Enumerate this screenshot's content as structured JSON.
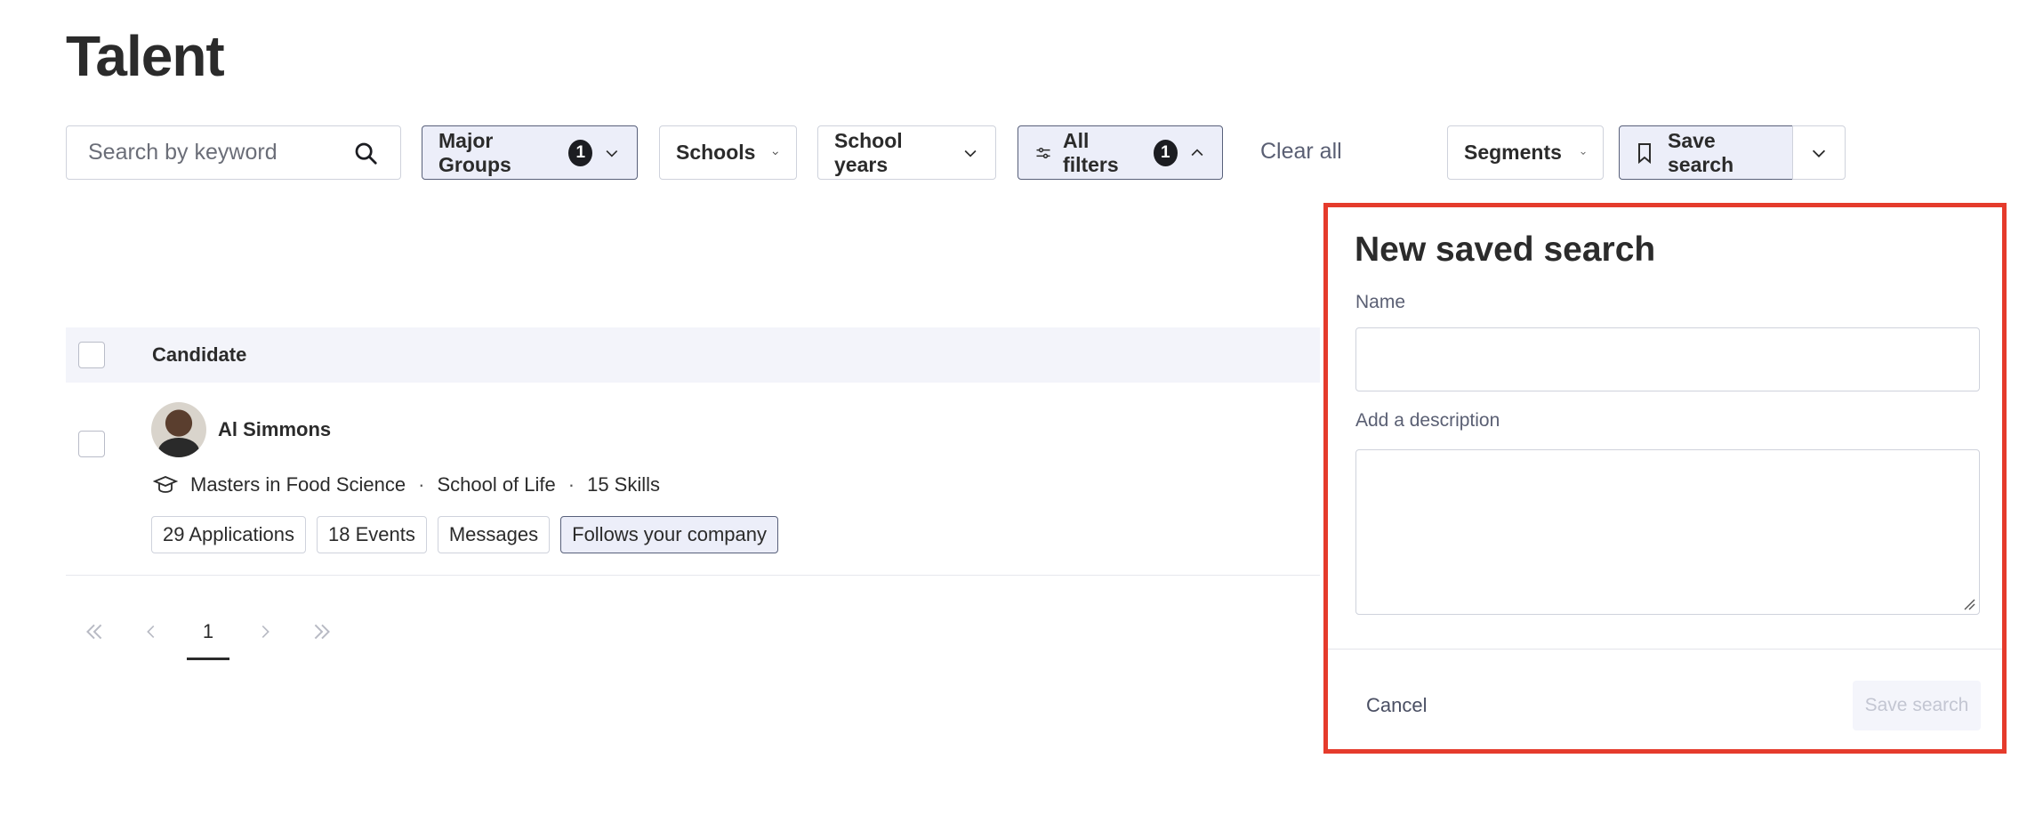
{
  "page": {
    "title": "Talent"
  },
  "toolbar": {
    "search_placeholder": "Search by keyword",
    "major_groups": {
      "label": "Major Groups",
      "count": "1"
    },
    "schools": {
      "label": "Schools"
    },
    "school_years": {
      "label": "School years"
    },
    "all_filters": {
      "label": "All filters",
      "count": "1"
    },
    "clear_all": "Clear all",
    "segments": "Segments",
    "save_search": "Save search"
  },
  "table": {
    "header": "Candidate",
    "rows": [
      {
        "name": "Al Simmons",
        "degree": "Masters in Food Science",
        "school": "School of Life",
        "skills": "15 Skills",
        "tags": [
          "29 Applications",
          "18 Events",
          "Messages",
          "Follows your company"
        ]
      }
    ]
  },
  "pagination": {
    "current": "1"
  },
  "popover": {
    "title": "New saved search",
    "name_label": "Name",
    "name_value": "",
    "description_label": "Add a description",
    "description_value": "",
    "cancel": "Cancel",
    "save": "Save search"
  },
  "colors": {
    "accent_border": "#58607a",
    "active_bg": "#eceef9",
    "highlight": "#e53b2c"
  }
}
